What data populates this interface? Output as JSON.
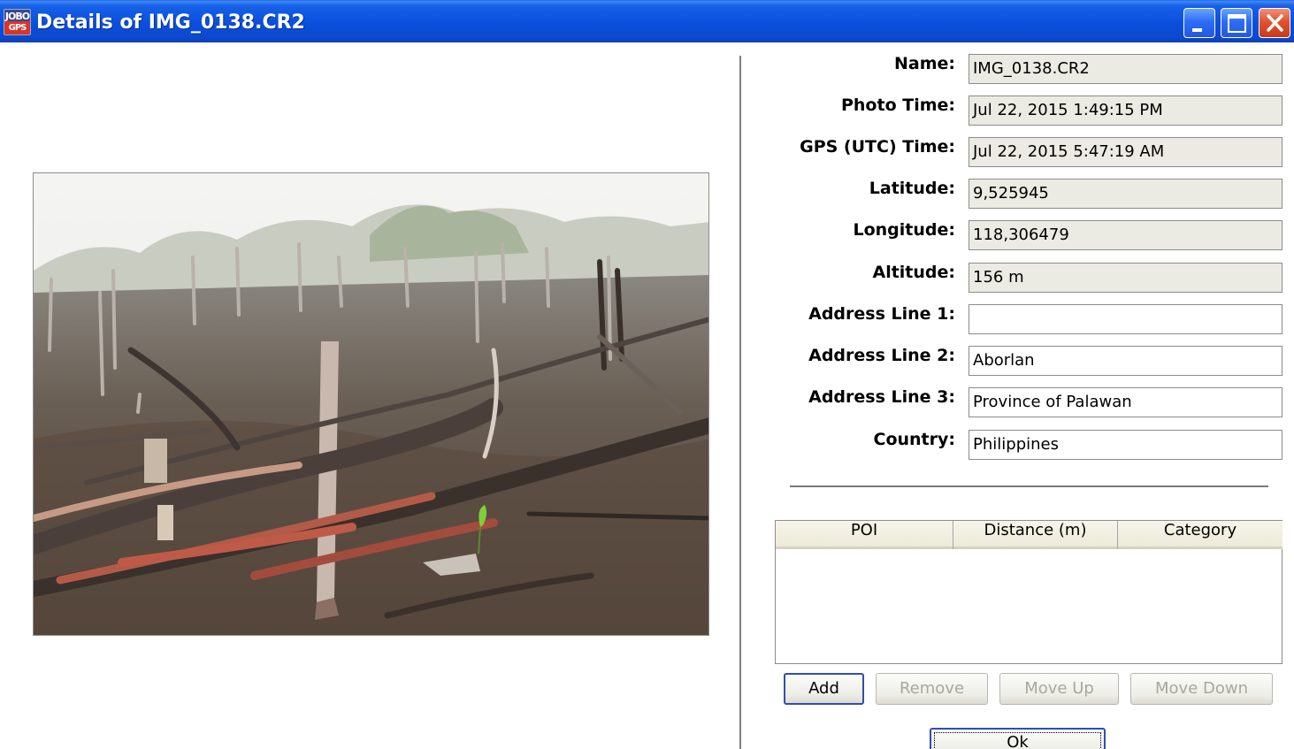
{
  "window": {
    "title": "Details of IMG_0138.CR2",
    "app_icon_top": "JOBO",
    "app_icon_bottom": "GPS"
  },
  "details": {
    "fields": [
      {
        "label": "Name:",
        "value": "IMG_0138.CR2",
        "editable": false
      },
      {
        "label": "Photo Time:",
        "value": "Jul 22, 2015 1:49:15 PM",
        "editable": false
      },
      {
        "label": "GPS (UTC) Time:",
        "value": "Jul 22, 2015 5:47:19 AM",
        "editable": false
      },
      {
        "label": "Latitude:",
        "value": "9,525945",
        "editable": false
      },
      {
        "label": "Longitude:",
        "value": "118,306479",
        "editable": false
      },
      {
        "label": "Altitude:",
        "value": "156 m",
        "editable": false
      },
      {
        "label": "Address Line 1:",
        "value": "",
        "editable": true
      },
      {
        "label": "Address Line 2:",
        "value": "Aborlan",
        "editable": true
      },
      {
        "label": "Address Line 3:",
        "value": "Province of Palawan",
        "editable": true
      },
      {
        "label": "Country:",
        "value": "Philippines",
        "editable": true
      }
    ]
  },
  "poi_table": {
    "columns": [
      "POI",
      "Distance (m)",
      "Category"
    ],
    "rows": []
  },
  "buttons": {
    "add": "Add",
    "remove": "Remove",
    "move_up": "Move Up",
    "move_down": "Move Down",
    "ok": "Ok"
  },
  "colors": {
    "titlebar": "#0a4fdc",
    "readonly_field": "#ebebe4",
    "focus_border": "#2f4fae"
  }
}
